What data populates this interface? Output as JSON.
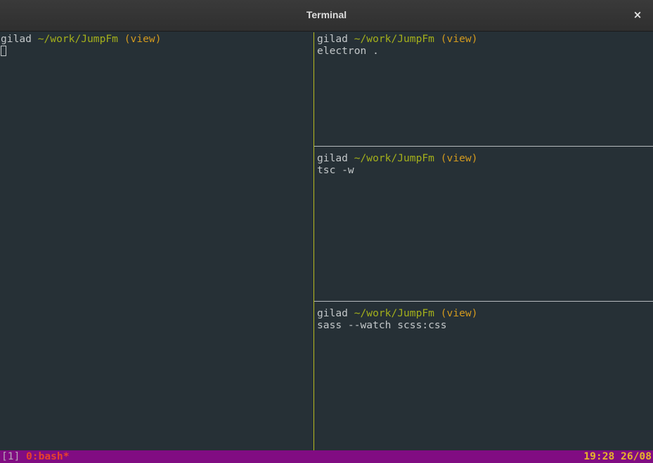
{
  "window": {
    "title": "Terminal",
    "close_glyph": "×"
  },
  "prompt": {
    "user": "gilad",
    "path": "~/work/JumpFm",
    "branch": "(view)"
  },
  "panes": [
    {
      "command": ""
    },
    {
      "command": "electron ."
    },
    {
      "command": "tsc -w"
    },
    {
      "command": "sass --watch scss:css"
    }
  ],
  "statusbar": {
    "session": "[1]",
    "window": "0:bash*",
    "clock": "19:28 26/08"
  },
  "colors": {
    "background": "#263036",
    "path": "#a4b01b",
    "branch": "#d39a1e",
    "statusbar": "#810c82",
    "active_window": "#e8422c",
    "clock": "#e7b52a"
  }
}
